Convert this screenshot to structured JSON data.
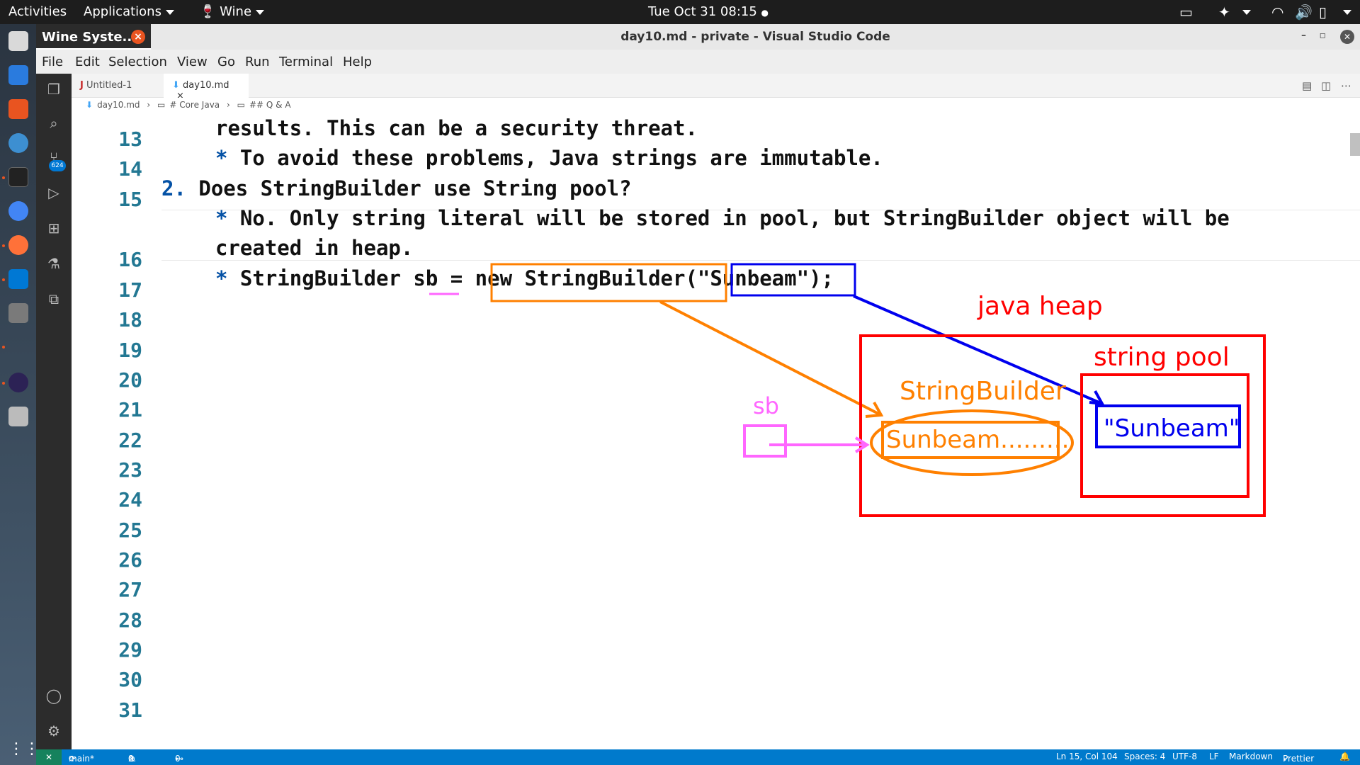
{
  "topbar": {
    "activities": "Activities",
    "applications": "Applications",
    "wine": "Wine",
    "datetime": "Tue Oct 31  08:15",
    "dot": "●"
  },
  "wine_popup": {
    "title": "Wine Syste...",
    "close": "×"
  },
  "window": {
    "title": "day10.md - private - Visual Studio Code"
  },
  "menu": {
    "file": "File",
    "edit": "Edit",
    "selection": "Selection",
    "view": "View",
    "go": "Go",
    "run": "Run",
    "terminal": "Terminal",
    "help": "Help"
  },
  "activity": {
    "scm_badge": "624"
  },
  "tabs": [
    {
      "icon": "J",
      "label": "Untitled-1"
    },
    {
      "icon": "⬇",
      "label": "day10.md",
      "close": "×"
    }
  ],
  "breadcrumb": {
    "file": "day10.md",
    "h1": "# Core Java",
    "h2": "## Q & A"
  },
  "editor": {
    "line_numbers": [
      "13",
      "14",
      "15",
      "16",
      "17",
      "18",
      "19",
      "20",
      "21",
      "22",
      "23",
      "24",
      "25",
      "26",
      "27",
      "28",
      "29",
      "30",
      "31"
    ],
    "lines": {
      "l12b": "results. This can be a security threat.",
      "l13": "* To avoid these problems, Java strings are immutable.",
      "l14": "2. Does StringBuilder use String pool?",
      "l15a": "* No. Only string literal will be stored in pool, but StringBuilder object will be",
      "l15b": "created in heap.",
      "l16": "* StringBuilder sb = new StringBuilder(\"Sunbeam\");"
    }
  },
  "annotations": {
    "java_heap": "java heap",
    "string_pool": "string pool",
    "stringbuilder": "StringBuilder",
    "sb": "sb",
    "sb_value": "Sunbeam.........",
    "pool_value": "\"Sunbeam\"",
    "colors": {
      "red": "#ff0000",
      "orange": "#ff8000",
      "blue": "#0000ee",
      "pink": "#ff66ff"
    }
  },
  "statusbar": {
    "branch": "main*",
    "errors": "0",
    "warnings": "0",
    "ports": "0",
    "position": "Ln 15, Col 104",
    "spaces": "Spaces: 4",
    "encoding": "UTF-8",
    "eol": "LF",
    "language": "Markdown",
    "prettier": "Prettier"
  }
}
